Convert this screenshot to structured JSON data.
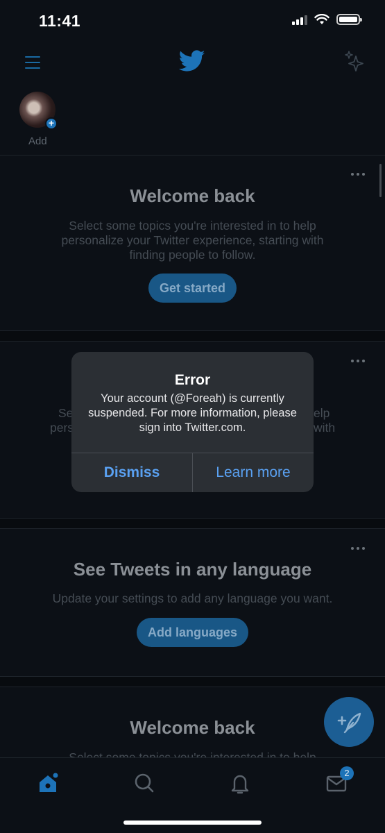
{
  "status_bar": {
    "time": "11:41"
  },
  "fleets": {
    "add_label": "Add"
  },
  "cards": [
    {
      "title": "Welcome back",
      "body": "Select some topics you're interested in to help personalize your Twitter experience, starting with finding people to follow.",
      "button": "Get started"
    },
    {
      "title": "",
      "body_left_fragment": "Se",
      "body_left_fragment_2": "pers",
      "body_right_fragment": "elp",
      "body_right_fragment_2": "with"
    },
    {
      "title": "See Tweets in any language",
      "body": "Update your settings to add any language you want.",
      "button": "Add languages"
    },
    {
      "title": "Welcome back",
      "body": "Select some topics you're interested in to help"
    }
  ],
  "alert": {
    "title": "Error",
    "message": "Your account (@Foreah) is currently suspended. For more information, please sign into Twitter.com.",
    "dismiss": "Dismiss",
    "learn_more": "Learn more"
  },
  "tabbar": {
    "items": [
      "home-icon",
      "search-icon",
      "bell-icon",
      "mail-icon"
    ],
    "messages_badge": "2"
  },
  "colors": {
    "background": "#0c1016",
    "accent": "#1d73b8",
    "alert_button": "#5aa1f2"
  }
}
